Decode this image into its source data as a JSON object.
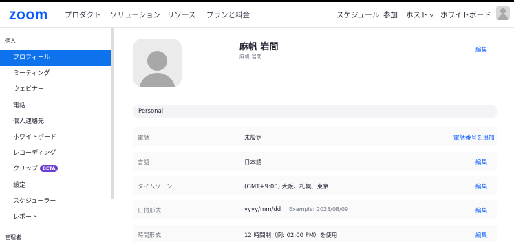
{
  "header": {
    "logo": "zoom",
    "nav": [
      "プロダクト",
      "ソリューション",
      "リソース",
      "プランと料金"
    ],
    "right": {
      "schedule": "スケジュール",
      "join": "参加",
      "host": "ホスト",
      "whiteboard": "ホワイトボード"
    }
  },
  "sidebar": {
    "section_personal": "個人",
    "items": [
      {
        "label": "プロフィール"
      },
      {
        "label": "ミーティング"
      },
      {
        "label": "ウェビナー"
      },
      {
        "label": "電話"
      },
      {
        "label": "個人連絡先"
      },
      {
        "label": "ホワイトボード"
      },
      {
        "label": "レコーディング"
      },
      {
        "label": "クリップ",
        "badge": "BETA"
      },
      {
        "label": "設定"
      },
      {
        "label": "スケジューラー"
      },
      {
        "label": "レポート"
      }
    ],
    "section_admin": "管理者"
  },
  "profile": {
    "name": "麻帆 岩間",
    "subname": "麻帆 岩間",
    "edit_label": "編集"
  },
  "personal": {
    "title": "Personal",
    "rows": [
      {
        "label": "電話",
        "value": "未設定",
        "example": "",
        "action": "電話番号を追加"
      },
      {
        "label": "言語",
        "value": "日本語",
        "example": "",
        "action": "編集"
      },
      {
        "label": "タイムゾーン",
        "value": "(GMT+9:00) 大阪、札幌、東京",
        "example": "",
        "action": "編集"
      },
      {
        "label": "日付形式",
        "value": "yyyy/mm/dd",
        "example": "Example: 2023/08/09",
        "action": "編集"
      },
      {
        "label": "時間形式",
        "value": "12 時間制（例: 02:00 PM）を使用",
        "example": "",
        "action": "編集"
      }
    ]
  },
  "colors": {
    "accent": "#0b5cff",
    "active_bg": "#0e72ed",
    "beta": "#6b3ccf"
  }
}
